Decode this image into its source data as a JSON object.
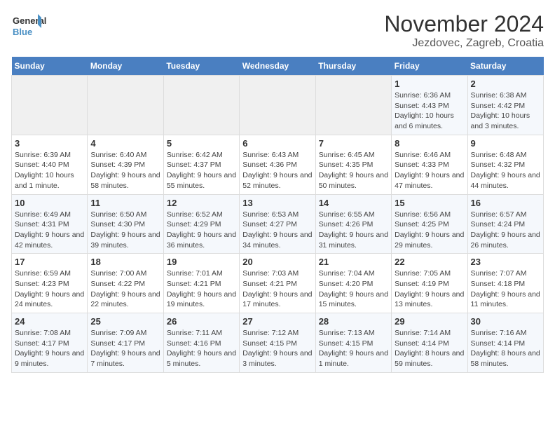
{
  "header": {
    "logo_line1": "General",
    "logo_line2": "Blue",
    "month": "November 2024",
    "location": "Jezdovec, Zagreb, Croatia"
  },
  "weekdays": [
    "Sunday",
    "Monday",
    "Tuesday",
    "Wednesday",
    "Thursday",
    "Friday",
    "Saturday"
  ],
  "weeks": [
    [
      {
        "day": "",
        "info": ""
      },
      {
        "day": "",
        "info": ""
      },
      {
        "day": "",
        "info": ""
      },
      {
        "day": "",
        "info": ""
      },
      {
        "day": "",
        "info": ""
      },
      {
        "day": "1",
        "info": "Sunrise: 6:36 AM\nSunset: 4:43 PM\nDaylight: 10 hours and 6 minutes."
      },
      {
        "day": "2",
        "info": "Sunrise: 6:38 AM\nSunset: 4:42 PM\nDaylight: 10 hours and 3 minutes."
      }
    ],
    [
      {
        "day": "3",
        "info": "Sunrise: 6:39 AM\nSunset: 4:40 PM\nDaylight: 10 hours and 1 minute."
      },
      {
        "day": "4",
        "info": "Sunrise: 6:40 AM\nSunset: 4:39 PM\nDaylight: 9 hours and 58 minutes."
      },
      {
        "day": "5",
        "info": "Sunrise: 6:42 AM\nSunset: 4:37 PM\nDaylight: 9 hours and 55 minutes."
      },
      {
        "day": "6",
        "info": "Sunrise: 6:43 AM\nSunset: 4:36 PM\nDaylight: 9 hours and 52 minutes."
      },
      {
        "day": "7",
        "info": "Sunrise: 6:45 AM\nSunset: 4:35 PM\nDaylight: 9 hours and 50 minutes."
      },
      {
        "day": "8",
        "info": "Sunrise: 6:46 AM\nSunset: 4:33 PM\nDaylight: 9 hours and 47 minutes."
      },
      {
        "day": "9",
        "info": "Sunrise: 6:48 AM\nSunset: 4:32 PM\nDaylight: 9 hours and 44 minutes."
      }
    ],
    [
      {
        "day": "10",
        "info": "Sunrise: 6:49 AM\nSunset: 4:31 PM\nDaylight: 9 hours and 42 minutes."
      },
      {
        "day": "11",
        "info": "Sunrise: 6:50 AM\nSunset: 4:30 PM\nDaylight: 9 hours and 39 minutes."
      },
      {
        "day": "12",
        "info": "Sunrise: 6:52 AM\nSunset: 4:29 PM\nDaylight: 9 hours and 36 minutes."
      },
      {
        "day": "13",
        "info": "Sunrise: 6:53 AM\nSunset: 4:27 PM\nDaylight: 9 hours and 34 minutes."
      },
      {
        "day": "14",
        "info": "Sunrise: 6:55 AM\nSunset: 4:26 PM\nDaylight: 9 hours and 31 minutes."
      },
      {
        "day": "15",
        "info": "Sunrise: 6:56 AM\nSunset: 4:25 PM\nDaylight: 9 hours and 29 minutes."
      },
      {
        "day": "16",
        "info": "Sunrise: 6:57 AM\nSunset: 4:24 PM\nDaylight: 9 hours and 26 minutes."
      }
    ],
    [
      {
        "day": "17",
        "info": "Sunrise: 6:59 AM\nSunset: 4:23 PM\nDaylight: 9 hours and 24 minutes."
      },
      {
        "day": "18",
        "info": "Sunrise: 7:00 AM\nSunset: 4:22 PM\nDaylight: 9 hours and 22 minutes."
      },
      {
        "day": "19",
        "info": "Sunrise: 7:01 AM\nSunset: 4:21 PM\nDaylight: 9 hours and 19 minutes."
      },
      {
        "day": "20",
        "info": "Sunrise: 7:03 AM\nSunset: 4:21 PM\nDaylight: 9 hours and 17 minutes."
      },
      {
        "day": "21",
        "info": "Sunrise: 7:04 AM\nSunset: 4:20 PM\nDaylight: 9 hours and 15 minutes."
      },
      {
        "day": "22",
        "info": "Sunrise: 7:05 AM\nSunset: 4:19 PM\nDaylight: 9 hours and 13 minutes."
      },
      {
        "day": "23",
        "info": "Sunrise: 7:07 AM\nSunset: 4:18 PM\nDaylight: 9 hours and 11 minutes."
      }
    ],
    [
      {
        "day": "24",
        "info": "Sunrise: 7:08 AM\nSunset: 4:17 PM\nDaylight: 9 hours and 9 minutes."
      },
      {
        "day": "25",
        "info": "Sunrise: 7:09 AM\nSunset: 4:17 PM\nDaylight: 9 hours and 7 minutes."
      },
      {
        "day": "26",
        "info": "Sunrise: 7:11 AM\nSunset: 4:16 PM\nDaylight: 9 hours and 5 minutes."
      },
      {
        "day": "27",
        "info": "Sunrise: 7:12 AM\nSunset: 4:15 PM\nDaylight: 9 hours and 3 minutes."
      },
      {
        "day": "28",
        "info": "Sunrise: 7:13 AM\nSunset: 4:15 PM\nDaylight: 9 hours and 1 minute."
      },
      {
        "day": "29",
        "info": "Sunrise: 7:14 AM\nSunset: 4:14 PM\nDaylight: 8 hours and 59 minutes."
      },
      {
        "day": "30",
        "info": "Sunrise: 7:16 AM\nSunset: 4:14 PM\nDaylight: 8 hours and 58 minutes."
      }
    ]
  ]
}
